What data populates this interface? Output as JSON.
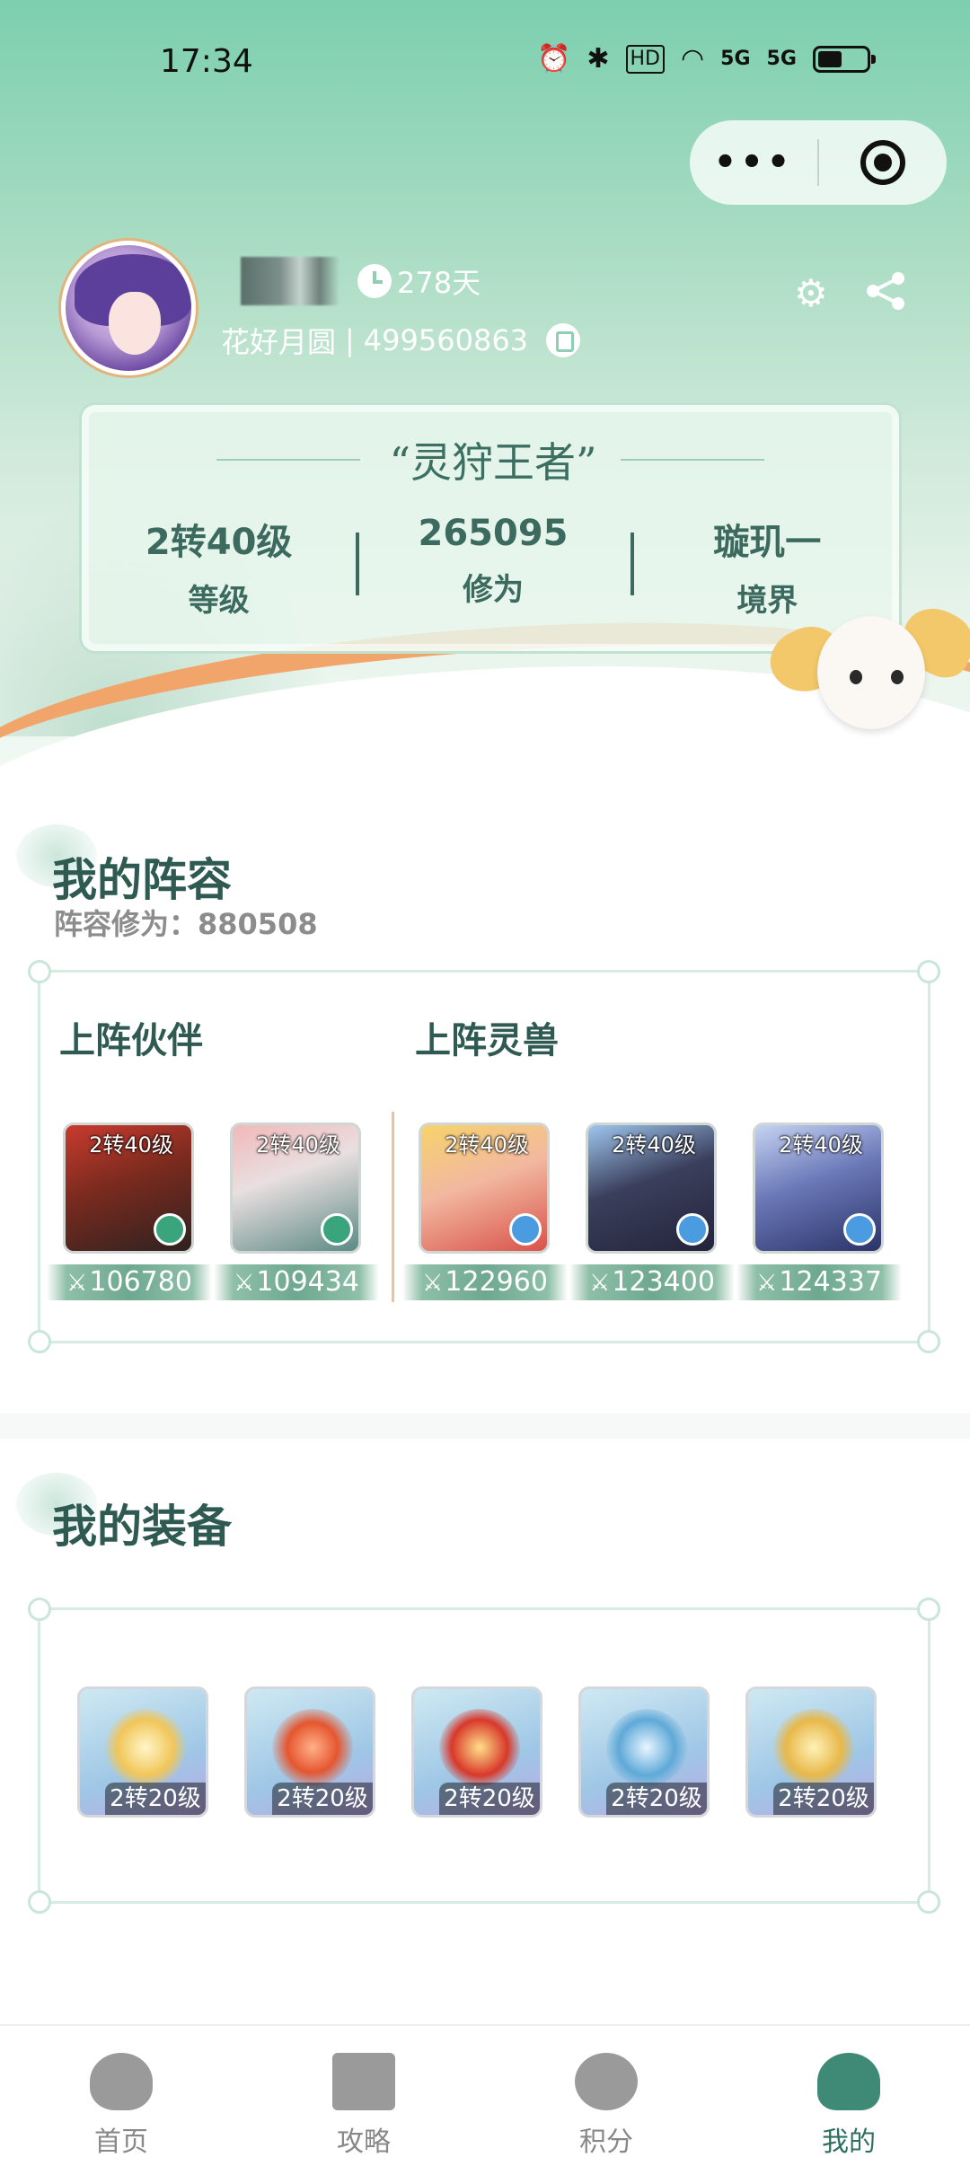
{
  "status_bar": {
    "time": "17:34",
    "icons": [
      "alarm-icon",
      "bluetooth-icon",
      "hd-icon",
      "wifi-icon",
      "5g-signal-icon",
      "5g-signal-icon",
      "battery-icon"
    ],
    "hd_label": "HD",
    "signal_1": "5G",
    "signal_2": "5G"
  },
  "capsule": {
    "more_label": "•••"
  },
  "profile": {
    "days": "278天",
    "server": "花好月圆",
    "separator": "|",
    "user_id": "499560863"
  },
  "title_card": {
    "title": "“灵狩王者”",
    "stats": [
      {
        "value": "2转40级",
        "label": "等级"
      },
      {
        "value": "265095",
        "label": "修为"
      },
      {
        "value": "璇玑一",
        "label": "境界"
      }
    ]
  },
  "lineup": {
    "title": "我的阵容",
    "subtitle": "阵容修为：880508",
    "partners_label": "上阵伙伴",
    "beasts_label": "上阵灵兽",
    "partners": [
      {
        "level": "2转40级",
        "power": "106780"
      },
      {
        "level": "2转40级",
        "power": "109434"
      }
    ],
    "beasts": [
      {
        "level": "2转40级",
        "power": "122960"
      },
      {
        "level": "2转40级",
        "power": "123400"
      },
      {
        "level": "2转40级",
        "power": "124337"
      }
    ]
  },
  "equipment": {
    "title": "我的装备",
    "items": [
      {
        "level": "2转20级"
      },
      {
        "level": "2转20级"
      },
      {
        "level": "2转20级"
      },
      {
        "level": "2转20级"
      },
      {
        "level": "2转20级"
      }
    ]
  },
  "tabbar": {
    "tabs": [
      {
        "label": "首页",
        "icon": "home-icon"
      },
      {
        "label": "攻略",
        "icon": "guide-icon"
      },
      {
        "label": "积分",
        "icon": "points-icon"
      },
      {
        "label": "我的",
        "icon": "mine-icon",
        "active": true
      }
    ]
  },
  "colors": {
    "accent": "#3d6a5f",
    "active_tab": "#2f6f5f",
    "header_top": "#7ccfaf",
    "wave": "#f2a56a"
  }
}
